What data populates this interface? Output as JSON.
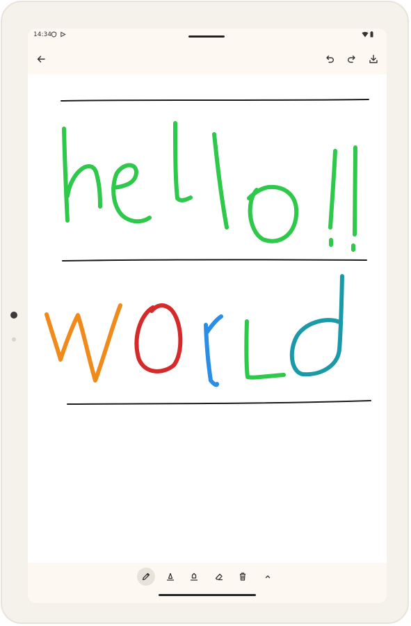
{
  "status_bar": {
    "time": "14:34"
  },
  "app_bar": {
    "back_icon": "arrow-left-icon",
    "undo_icon": "undo-icon",
    "redo_icon": "redo-icon",
    "save_icon": "download-icon"
  },
  "canvas": {
    "line_color": "#1a1a1a",
    "stroke_colors": {
      "hello": "#2ec84a",
      "w": "#f08a1a",
      "o": "#d62a2a",
      "r": "#2a8ee6",
      "l": "#2ec84a",
      "d": "#1a9aa8"
    }
  },
  "toolbar": {
    "tools": [
      {
        "name": "pen-tool",
        "icon": "pen-icon",
        "active": true
      },
      {
        "name": "highlighter-tool",
        "icon": "highlighter-icon",
        "active": false
      },
      {
        "name": "marker-tool",
        "icon": "marker-icon",
        "active": false
      },
      {
        "name": "eraser-tool",
        "icon": "eraser-icon",
        "active": false
      },
      {
        "name": "clear-tool",
        "icon": "trash-icon",
        "active": false
      },
      {
        "name": "expand-toolbar",
        "icon": "chevron-up-icon",
        "active": false
      }
    ]
  }
}
